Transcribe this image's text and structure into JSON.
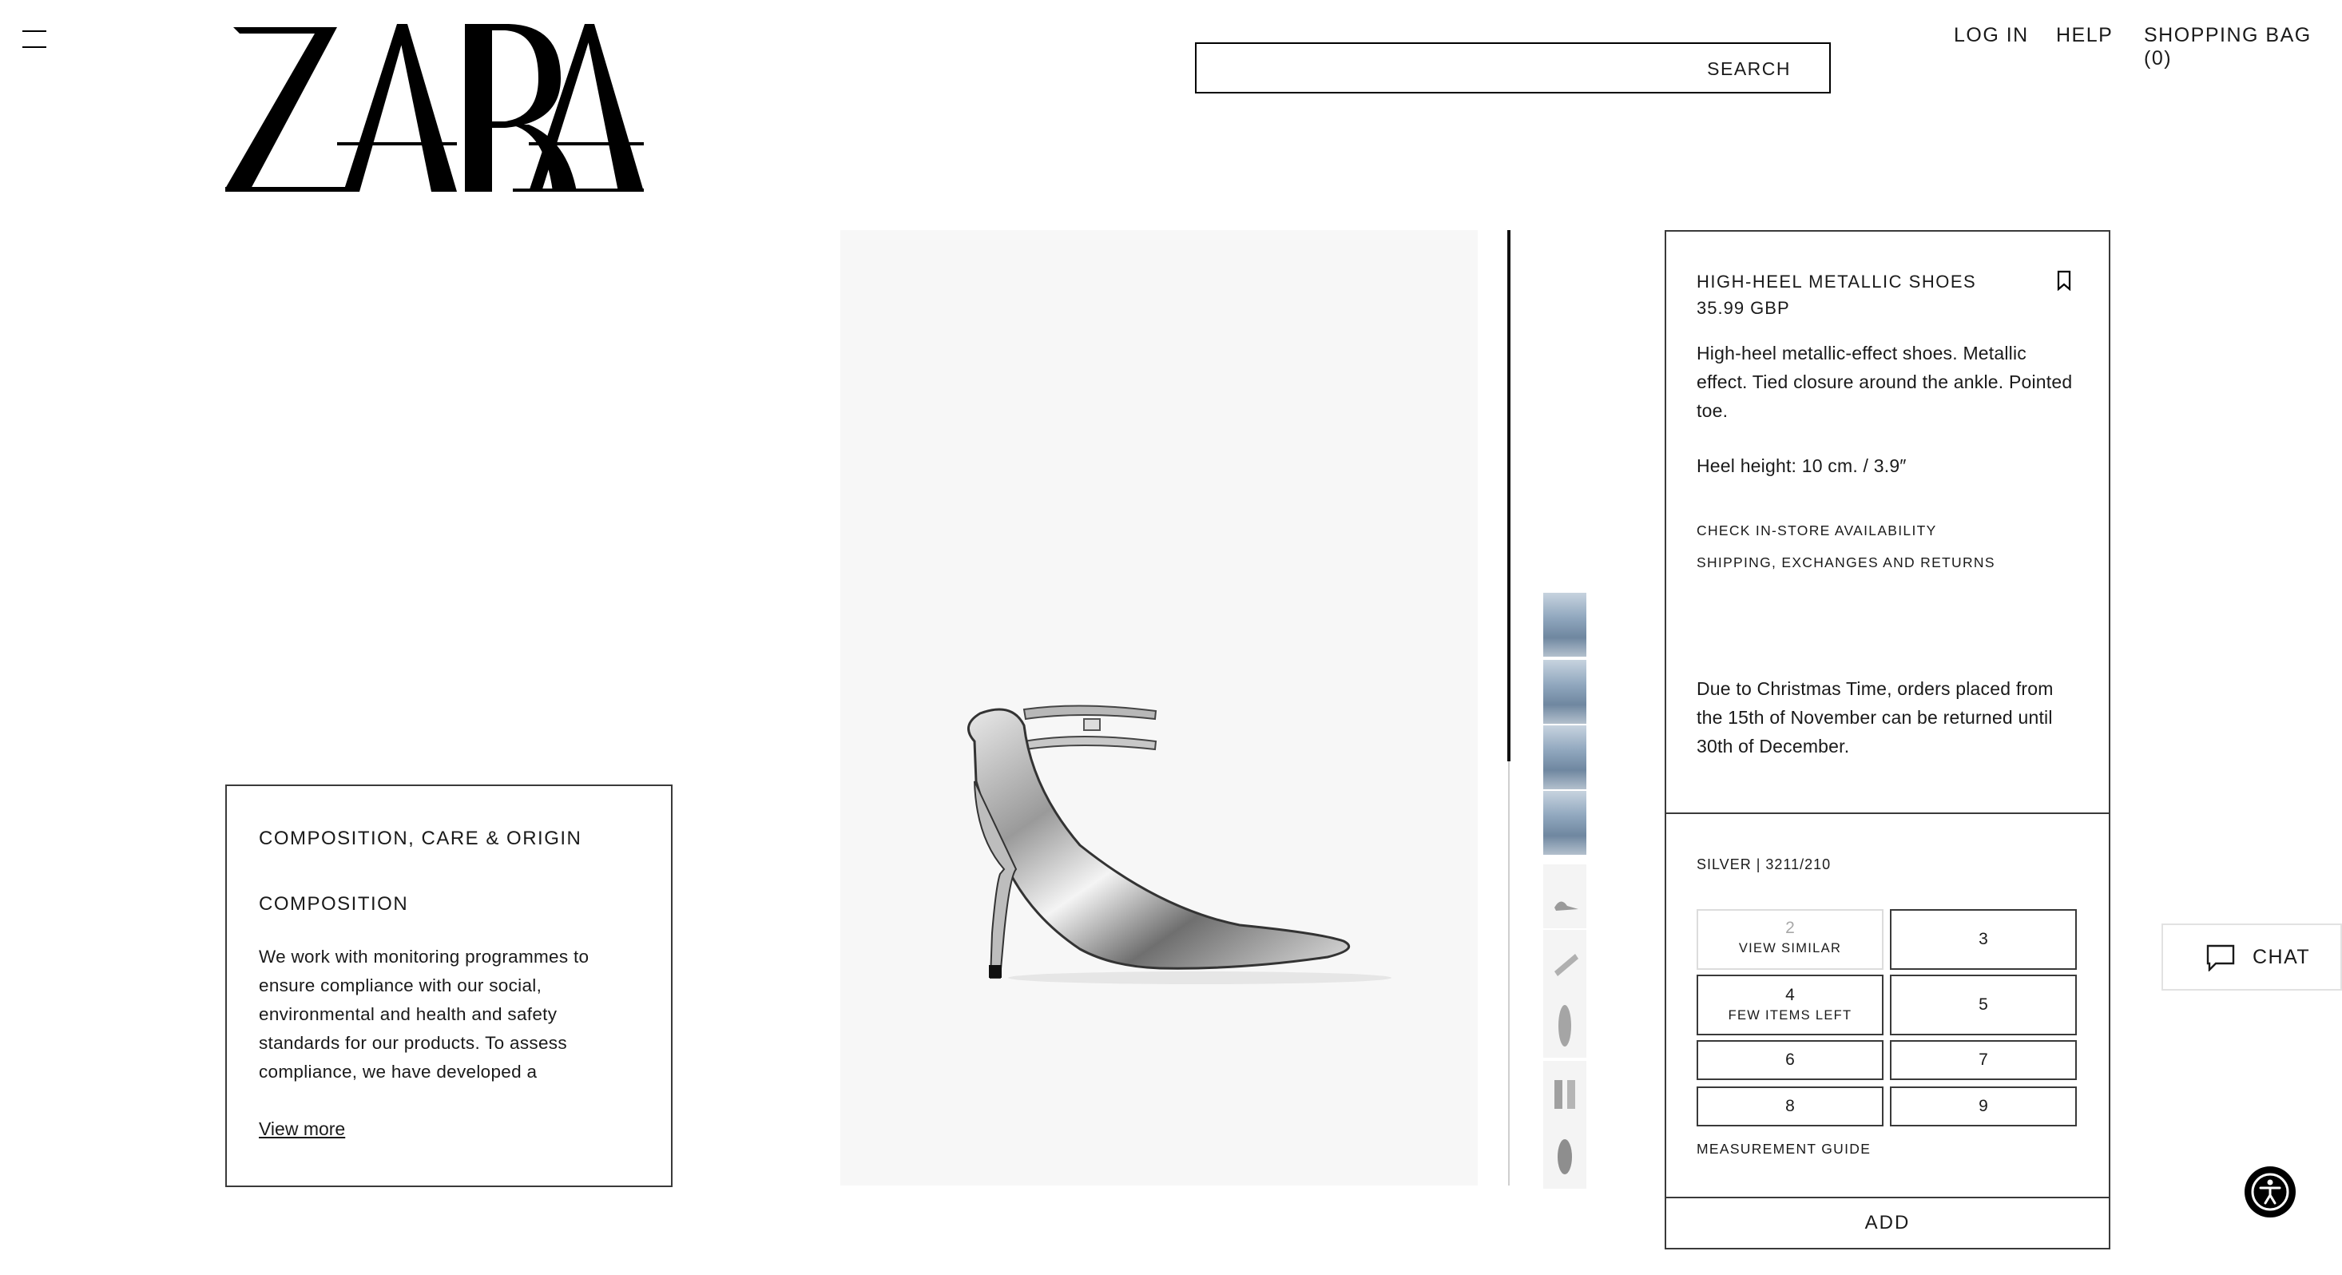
{
  "header": {
    "brand": "ZARA",
    "search_label": "SEARCH",
    "search_value": "",
    "links": {
      "login": "LOG IN",
      "help": "HELP",
      "bag": "SHOPPING BAG (0)"
    }
  },
  "composition": {
    "title": "COMPOSITION, CARE & ORIGIN",
    "subtitle": "COMPOSITION",
    "body": "We work with monitoring programmes to ensure compliance with our social, environmental and health and safety standards for our products. To assess compliance, we have developed a",
    "view_more": "View more"
  },
  "product": {
    "name": "HIGH-HEEL METALLIC SHOES",
    "price": "35.99 GBP",
    "description": "High-heel metallic-effect shoes. Metallic effect. Tied closure around the ankle. Pointed toe.",
    "heel_height": "Heel height: 10 cm. / 3.9″",
    "links": {
      "availability": "CHECK IN-STORE AVAILABILITY",
      "shipping": "SHIPPING, EXCHANGES AND RETURNS"
    },
    "notice": "Due to Christmas Time, orders placed from the 15th of November can be returned until 30th of December.",
    "color_ref": "SILVER | 3211/210",
    "sizes": [
      {
        "label": "2",
        "note": "VIEW SIMILAR",
        "state": "unavailable"
      },
      {
        "label": "3",
        "note": "",
        "state": "available"
      },
      {
        "label": "4",
        "note": "FEW ITEMS LEFT",
        "state": "low-stock"
      },
      {
        "label": "5",
        "note": "",
        "state": "available"
      },
      {
        "label": "6",
        "note": "",
        "state": "available"
      },
      {
        "label": "7",
        "note": "",
        "state": "available"
      },
      {
        "label": "8",
        "note": "",
        "state": "available"
      },
      {
        "label": "9",
        "note": "",
        "state": "available"
      }
    ],
    "measurement_guide": "MEASUREMENT GUIDE",
    "add_label": "ADD",
    "thumbnail_count": 9
  },
  "chat": {
    "label": "CHAT"
  },
  "icons": {
    "menu": "menu-icon",
    "bookmark": "bookmark-icon",
    "chat": "chat-bubble-icon",
    "accessibility": "accessibility-icon"
  },
  "colors": {
    "text": "#1a1a1a",
    "border": "#3a3a3a",
    "accent": "#000000",
    "muted": "#a8a8a8"
  }
}
